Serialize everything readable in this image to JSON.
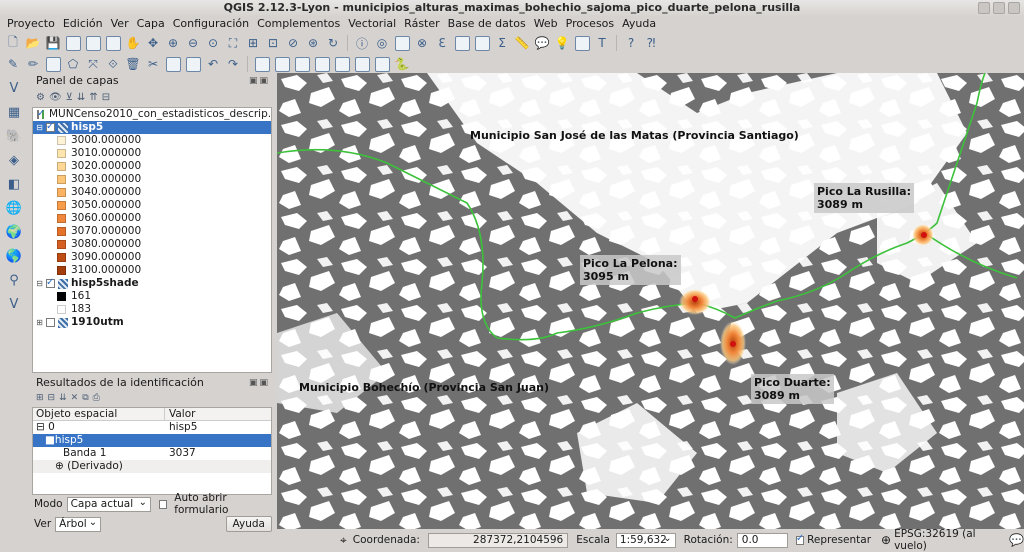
{
  "window": {
    "title": "QGIS 2.12.3-Lyon - municipios_alturas_maximas_bohechio_sajoma_pico_duarte_pelona_rusilla"
  },
  "menu": [
    "Proyecto",
    "Edición",
    "Ver",
    "Capa",
    "Configuración",
    "Complementos",
    "Vectorial",
    "Ráster",
    "Base de datos",
    "Web",
    "Procesos",
    "Ayuda"
  ],
  "layers_panel": {
    "title": "Panel de capas",
    "layers": [
      {
        "name": "MUNCenso2010_con_estadisticos_descrip...",
        "checked": true,
        "type": "vector"
      },
      {
        "name": "hisp5",
        "checked": true,
        "selected": true,
        "type": "raster",
        "classes": [
          {
            "label": "3000.000000",
            "color": "#fff3d6"
          },
          {
            "label": "3010.000000",
            "color": "#fde5b0"
          },
          {
            "label": "3020.000000",
            "color": "#fdd796"
          },
          {
            "label": "3030.000000",
            "color": "#fcc679"
          },
          {
            "label": "3040.000000",
            "color": "#fbb262"
          },
          {
            "label": "3050.000000",
            "color": "#f89c4a"
          },
          {
            "label": "3060.000000",
            "color": "#f1873a"
          },
          {
            "label": "3070.000000",
            "color": "#e5722b"
          },
          {
            "label": "3080.000000",
            "color": "#d45f20"
          },
          {
            "label": "3090.000000",
            "color": "#bd4c15"
          },
          {
            "label": "3100.000000",
            "color": "#a33d0c"
          }
        ]
      },
      {
        "name": "hisp5shade",
        "checked": true,
        "type": "raster",
        "classes": [
          {
            "label": "161",
            "color": "#000000"
          },
          {
            "label": "183",
            "color": "#ffffff"
          }
        ]
      },
      {
        "name": "1910utm",
        "checked": false,
        "type": "raster"
      }
    ]
  },
  "identify_panel": {
    "title": "Resultados de la identificación",
    "col_feature": "Objeto espacial",
    "col_value": "Valor",
    "rows": [
      {
        "feature": "0",
        "value": "hisp5",
        "prefix": "⊟"
      },
      {
        "feature": "hisp5",
        "value": "",
        "prefix": "■",
        "selected": true
      },
      {
        "feature": "Banda 1",
        "value": "3037",
        "prefix": ""
      },
      {
        "feature": "(Derivado)",
        "value": "",
        "prefix": "⊕"
      }
    ],
    "mode_label": "Modo",
    "mode_value": "Capa actual",
    "auto_open_label": "Auto abrir formulario",
    "view_label": "Ver",
    "view_value": "Árbol",
    "help_label": "Ayuda"
  },
  "map": {
    "label_north": "Municipio San José de las Matas (Provincia Santiago)",
    "label_south": "Municipio Bohechío (Provincia San Juan)",
    "peaks": [
      {
        "name": "Pico La Rusilla:",
        "elev": "3089 m"
      },
      {
        "name": "Pico La Pelona:",
        "elev": "3095 m"
      },
      {
        "name": "Pico Duarte:",
        "elev": "3089 m"
      }
    ]
  },
  "statusbar": {
    "coord_label": "Coordenada:",
    "coord_value": "287372,2104596",
    "scale_label": "Escala",
    "scale_value": "1:59,632",
    "rotation_label": "Rotación:",
    "rotation_value": "0.0",
    "render_label": "Representar",
    "crs_label": "EPSG:32619 (al vuelo)"
  }
}
